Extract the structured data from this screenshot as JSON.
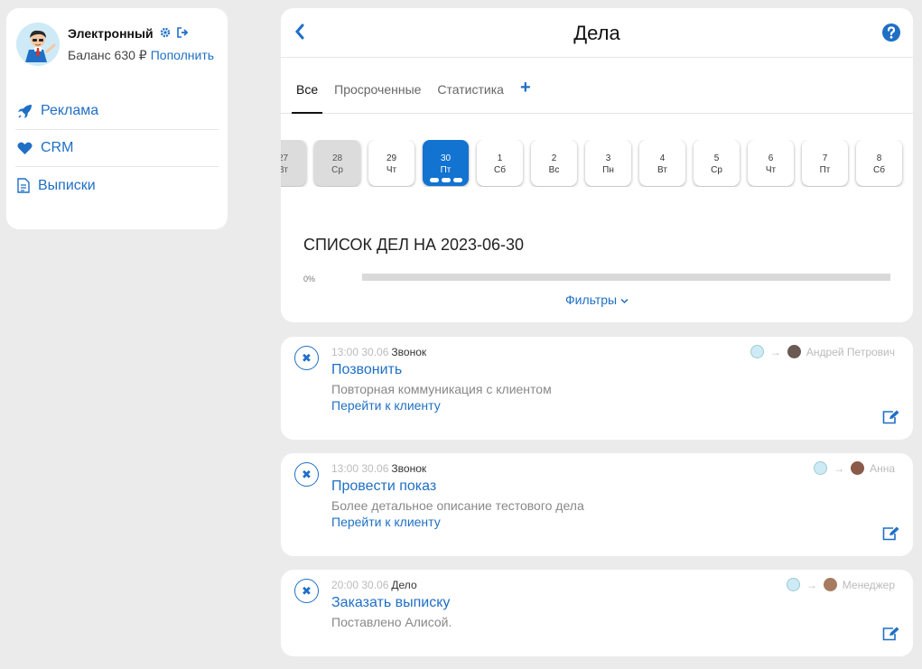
{
  "user": {
    "name": "Электронный",
    "balance_label": "Баланс 630 ₽",
    "topup_label": "Пополнить"
  },
  "menu": [
    {
      "label": "Реклама",
      "icon": "rocket-icon"
    },
    {
      "label": "CRM",
      "icon": "heart-icon"
    },
    {
      "label": "Выписки",
      "icon": "document-icon"
    }
  ],
  "header": {
    "title": "Дела"
  },
  "tabs": [
    {
      "label": "Все",
      "active": true
    },
    {
      "label": "Просроченные"
    },
    {
      "label": "Статистика"
    },
    {
      "label": "+"
    }
  ],
  "days": [
    {
      "num": "27",
      "dow": "Вт",
      "past": true
    },
    {
      "num": "28",
      "dow": "Ср",
      "past": true
    },
    {
      "num": "29",
      "dow": "Чт"
    },
    {
      "num": "30",
      "dow": "Пт",
      "selected": true
    },
    {
      "num": "1",
      "dow": "Сб"
    },
    {
      "num": "2",
      "dow": "Вс"
    },
    {
      "num": "3",
      "dow": "Пн"
    },
    {
      "num": "4",
      "dow": "Вт"
    },
    {
      "num": "5",
      "dow": "Ср"
    },
    {
      "num": "6",
      "dow": "Чт"
    },
    {
      "num": "7",
      "dow": "Пт"
    },
    {
      "num": "8",
      "dow": "Сб"
    }
  ],
  "list": {
    "title": "СПИСОК ДЕЛ НА 2023-06-30",
    "progress_label": "0%",
    "progress": 0,
    "filters_label": "Фильтры"
  },
  "tasks": [
    {
      "time": "13:00 30.06",
      "type": "Звонок",
      "title": "Позвонить",
      "description": "Повторная коммуникация с клиентом",
      "link": "Перейти к клиенту",
      "assignee": "Андрей Петрович"
    },
    {
      "time": "13:00 30.06",
      "type": "Звонок",
      "title": "Провести показ",
      "description": "Более детальное описание тестового дела",
      "link": "Перейти к клиенту",
      "assignee": "Анна"
    },
    {
      "time": "20:00 30.06",
      "type": "Дело",
      "title": "Заказать выписку",
      "description": "Поставлено Алисой.",
      "assignee": "Менеджер"
    }
  ],
  "colors": {
    "accent": "#1f6fc5",
    "selected_day": "#1273d1",
    "background": "#ebebeb"
  }
}
